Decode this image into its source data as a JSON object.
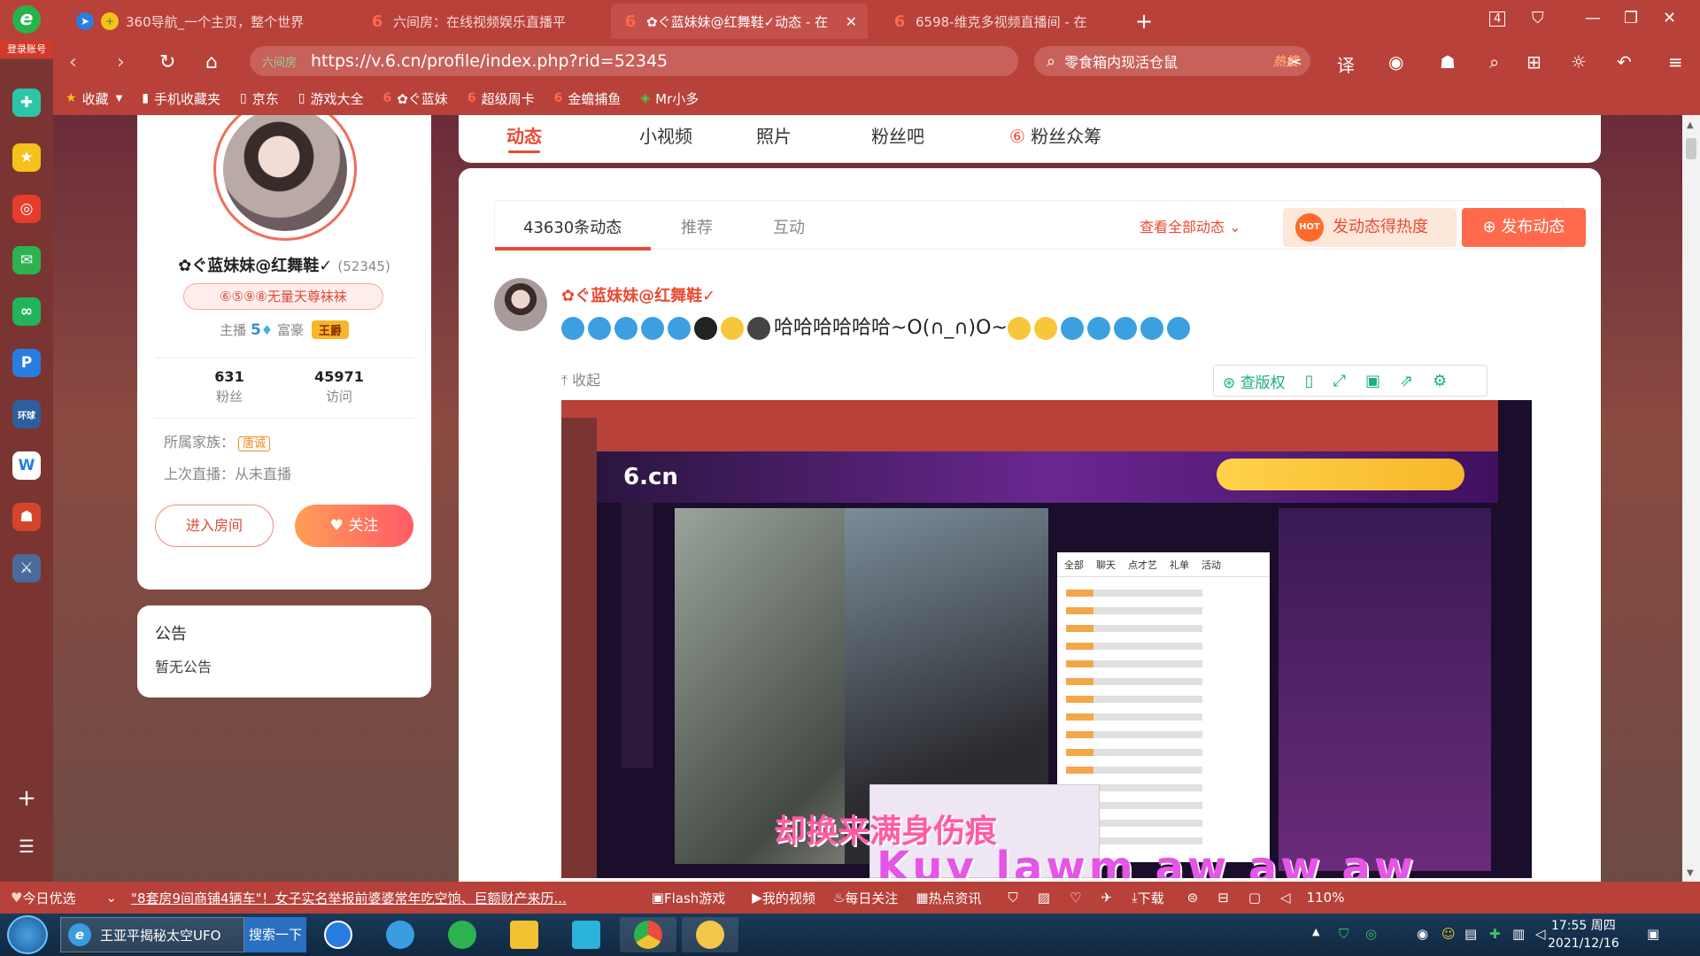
{
  "browser": {
    "logo_text": "登录账号",
    "tabs": [
      {
        "label": "360导航_一个主页，整个世界",
        "active": false
      },
      {
        "label": "六间房：在线视频娱乐直播平",
        "active": false
      },
      {
        "label": "✿ぐ蓝妹妹@红舞鞋✓动态 - 在",
        "active": true
      },
      {
        "label": "6598-维克多视频直播间 - 在",
        "active": false
      }
    ],
    "tab_count": "4",
    "url_safe": "六间房",
    "url": "https://v.6.cn/profile/index.php?rid=52345",
    "search_query": "零食箱内现活仓鼠",
    "search_hot": "热搜",
    "bookmarks": [
      "收藏",
      "手机收藏夹",
      "京东",
      "游戏大全",
      "✿ぐ蓝妹",
      "超级周卡",
      "金蟾捕鱼",
      "Mr小多"
    ]
  },
  "top_tabs": [
    "动态",
    "小视频",
    "照片",
    "粉丝吧",
    "粉丝众筹"
  ],
  "profile": {
    "name": "✿ぐ蓝妹妹@红舞鞋✓",
    "rid": "(52345)",
    "label": "⑥⑤⑨⑧无量天尊袜袜",
    "anchor_label": "主播",
    "anchor_level": "5",
    "rich_label": "富豪",
    "rich_badge": "王爵",
    "fans_count": "631",
    "fans_label": "粉丝",
    "visits_count": "45971",
    "visits_label": "访问",
    "family_label": "所属家族：",
    "family_value": "唐诚",
    "last_live": "上次直播：从未直播",
    "enter_room": "进入房间",
    "follow": "关注"
  },
  "notice": {
    "title": "公告",
    "content": "暂无公告"
  },
  "feed": {
    "tabs": [
      "43630条动态",
      "推荐",
      "互动"
    ],
    "view_all": "查看全部动态",
    "hot_btn": "发动态得热度",
    "hot_badge": "HOT",
    "post_btn": "发布动态",
    "post": {
      "name": "✿ぐ蓝妹妹@红舞鞋✓",
      "text": "哈哈哈哈哈哈~O(∩_∩)O~",
      "fold": "收起",
      "tools": [
        "查版权"
      ]
    }
  },
  "stream": {
    "logo": "6.cn",
    "chat_tabs": [
      "全部",
      "聊天",
      "点才艺",
      "礼单",
      "活动"
    ],
    "sub1": "却换来满身伤痕",
    "sub2": "Kuv  lawm  aw  aw  aw"
  },
  "statusbar": {
    "today": "今日优选",
    "news": "\"8套房9间商铺4辆车\"！女子实名举报前婆婆常年吃空饷、巨额财产来历...",
    "flash": "Flash游戏",
    "myvideo": "我的视频",
    "daily": "每日关注",
    "hot": "热点资讯",
    "download": "下载",
    "zoom": "110%"
  },
  "taskbar": {
    "ie_title": "王亚平揭秘太空UFO",
    "search": "搜索一下",
    "time": "17:55 周四",
    "date": "2021/12/16"
  }
}
